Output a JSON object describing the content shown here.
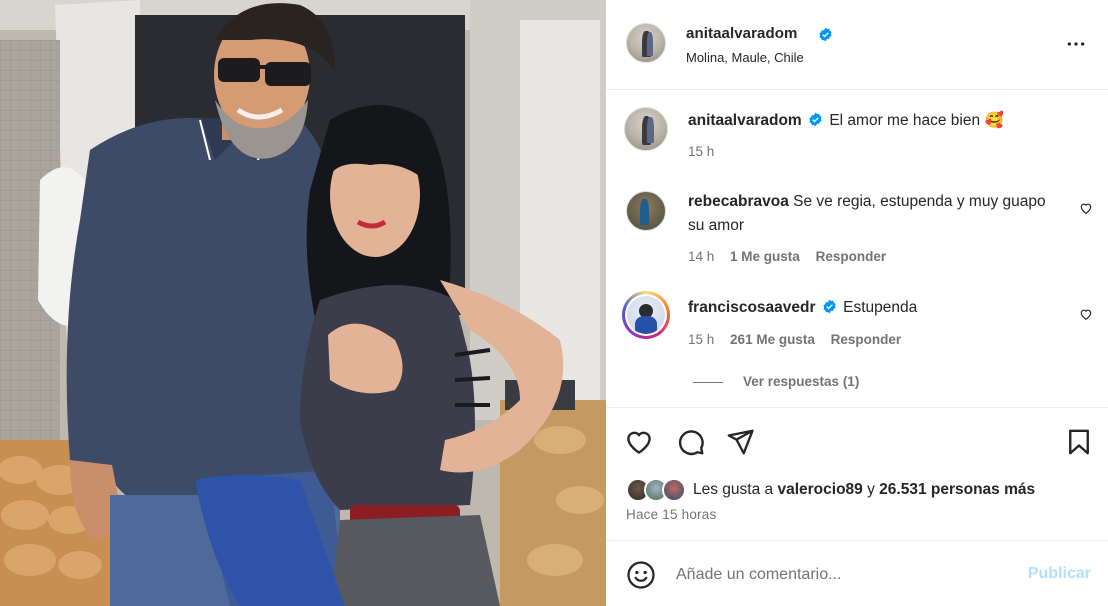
{
  "post": {
    "author": "anitaalvaradom",
    "location": "Molina, Maule, Chile",
    "caption": "El amor me hace bien",
    "caption_emoji": "🥰",
    "caption_time": "15 h"
  },
  "comments": [
    {
      "user": "rebecabravoa",
      "text": "Se ve regia, estupenda y muy guapo su amor",
      "time": "14 h",
      "likes": "1 Me gusta",
      "reply": "Responder"
    },
    {
      "user": "franciscosaavedr",
      "text": "Estupenda",
      "time": "15 h",
      "likes": "261 Me gusta",
      "reply": "Responder"
    }
  ],
  "view_replies": "Ver respuestas (1)",
  "likes_summary": {
    "prefix": "Les gusta a",
    "user": "valerocio89",
    "middle": "y",
    "count": "26.531 personas más"
  },
  "time_ago": "Hace 15 horas",
  "comment_input": {
    "placeholder": "Añade un comentario...",
    "publish": "Publicar"
  },
  "icons": {
    "header_more": "more-horizontal-icon",
    "like": "heart-icon",
    "comment": "comment-bubble-icon",
    "share": "send-paper-plane-icon",
    "save": "bookmark-icon",
    "emoji": "emoji-smile-icon",
    "verified": "verified-badge-icon"
  },
  "colors": {
    "verified": "#0095f6",
    "publish_disabled": "#b2dffc",
    "story_ring": "#d300c5"
  }
}
